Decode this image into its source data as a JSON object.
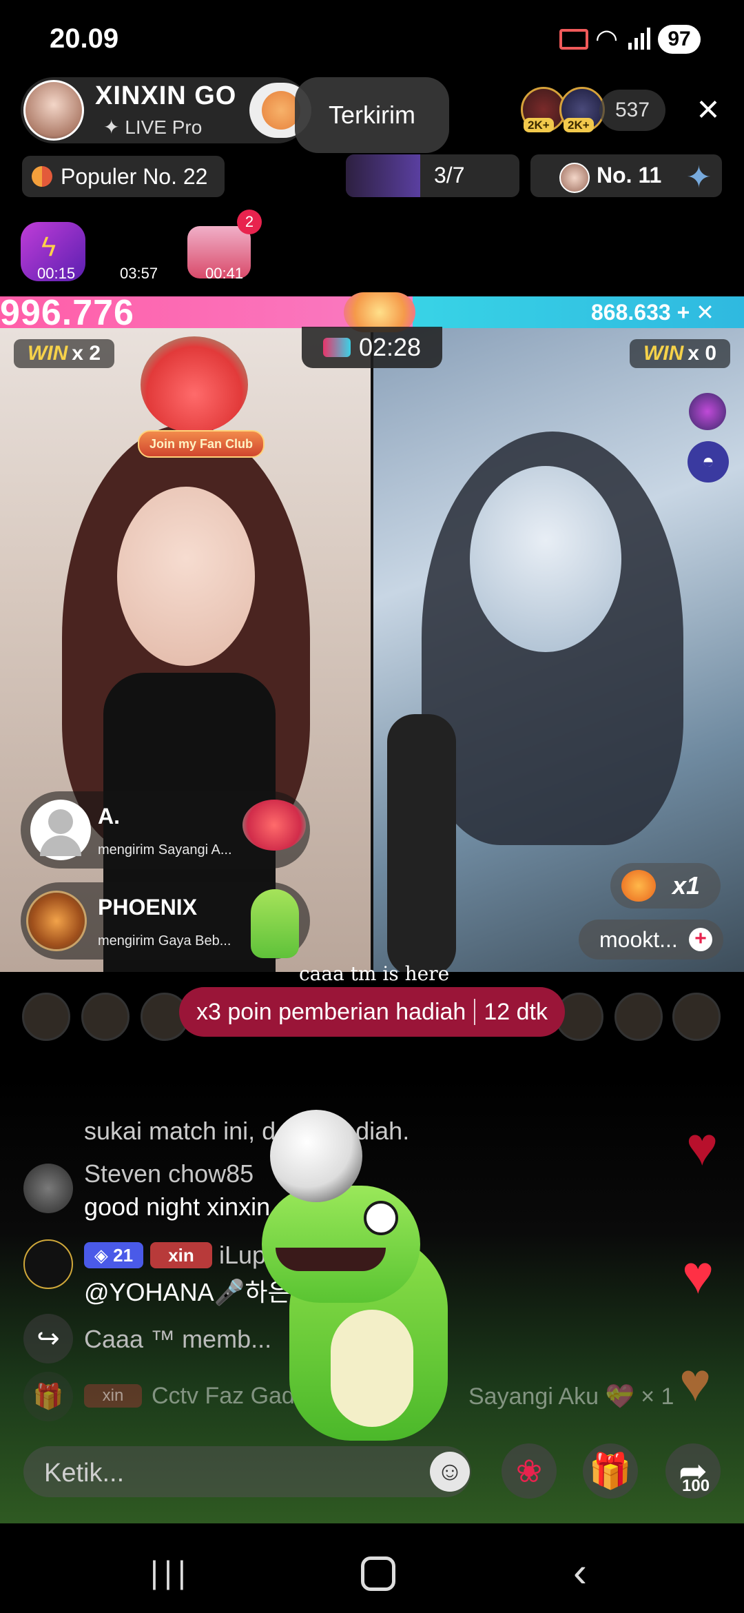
{
  "status_bar": {
    "time": "20.09",
    "battery": "97"
  },
  "host": {
    "name": "XINXIN GO",
    "badge": "✦ LIVE Pro"
  },
  "toast": "Terkirim",
  "viewers": {
    "badge1": "2K+",
    "badge2": "2K+",
    "count": "537"
  },
  "popular": "Populer No. 22",
  "rank": {
    "progress": "3/7",
    "number": "No. 11"
  },
  "items": {
    "bolt_timer": "00:15",
    "middle_timer": "03:57",
    "chest_timer": "00:41",
    "chest_badge": "2"
  },
  "battle": {
    "score_left": "996.776",
    "score_right": "868.633 + ✕",
    "left_win_word": "WIN",
    "left_win_mult": "x 2",
    "right_win_word": "WIN",
    "right_win_mult": "x 0",
    "timer": "02:28",
    "fan_club": "Join my Fan Club",
    "score_left_share": 0.555
  },
  "gifts": [
    {
      "name": "A.",
      "text": "mengirim Sayangi A..."
    },
    {
      "name": "PHOENIX",
      "text": "mengirim Gaya Beb..."
    }
  ],
  "combo": "x1",
  "guest_name": "mookt...",
  "caption": "caaa tm is here",
  "bonus": {
    "text": "x3 poin pemberian hadiah",
    "time": "12 dtk"
  },
  "chat": {
    "line0": "sukai match ini, d...m Hadiah.",
    "steven_name": "Steven chow85",
    "steven_msg": "good night xinxin",
    "drw_level": "◈ 21",
    "drw_fan": "xin",
    "drw_name": "iLupl",
    "drw_msg": "@YOHANA🎤하은...ek palu",
    "caaa_msg": "Caaa ™ memb...",
    "cctv_badge": "xin",
    "cctv_msg": "Cctv Faz Gad...",
    "cctv_right": "Sayangi Aku 💝 × 1"
  },
  "input": {
    "placeholder": "Ketik..."
  },
  "share_count": "100",
  "icons": {
    "close": "close-icon",
    "bolt": "lightning-icon",
    "chest": "treasure-chest-icon",
    "emoji": "smile-icon",
    "rose": "rose-icon",
    "gift": "gift-icon",
    "share": "share-icon"
  },
  "colors": {
    "left_team": "#ff5ea8",
    "right_team": "#38d3e6",
    "bonus_bg": "#9a1538",
    "heart": "#e8234e"
  }
}
